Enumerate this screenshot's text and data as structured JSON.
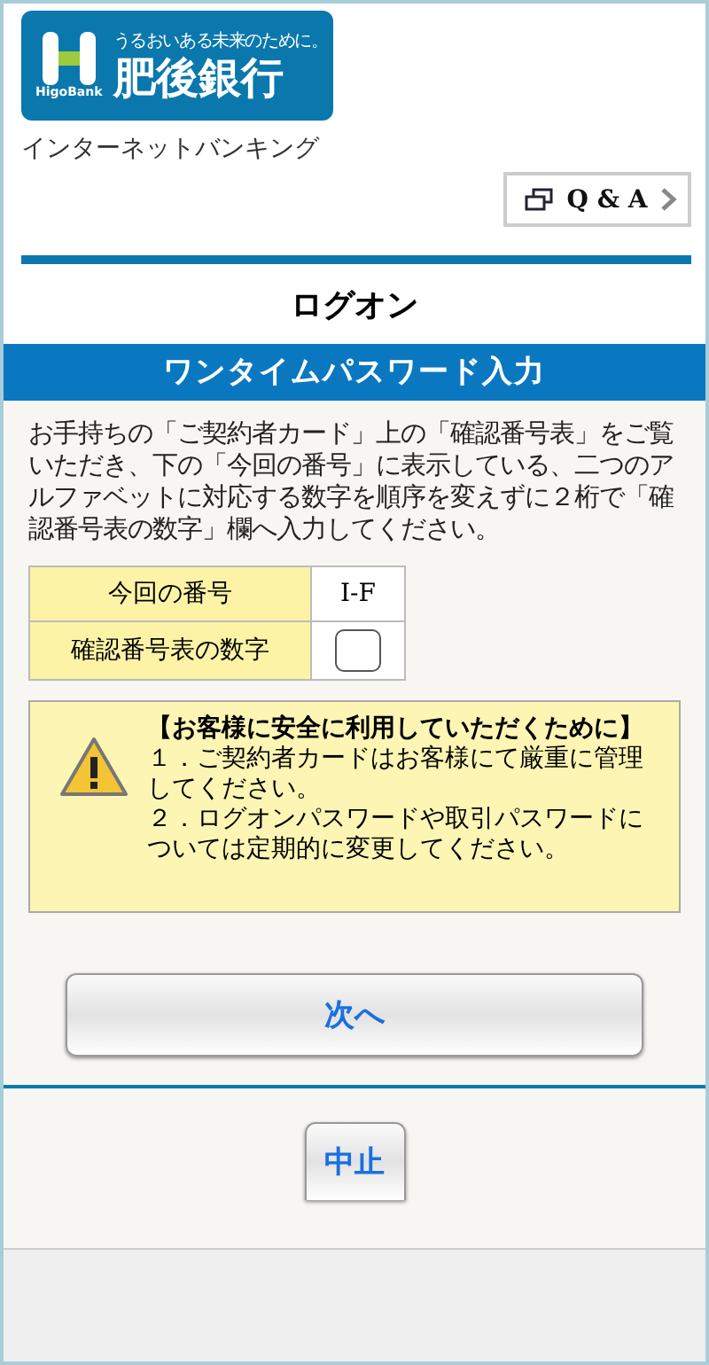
{
  "header": {
    "logo": {
      "tagline": "うるおいある未来のために。",
      "name": "肥後銀行",
      "roman": "HigoBank"
    },
    "service": "インターネットバンキング",
    "qa_button": {
      "label": "Q & A"
    }
  },
  "page_title": "ログオン",
  "section_title": "ワンタイムパスワード入力",
  "instructions": "お手持ちの「ご契約者カード」上の「確認番号表」をご覧いただき、下の「今回の番号」に表示している、二つのアルファベットに対応する数字を順序を変えずに２桁で「確認番号表の数字」欄へ入力してください。",
  "form_rows": [
    {
      "kind": "text",
      "label": "今回の番号",
      "value": "I-F"
    },
    {
      "kind": "input",
      "label": "確認番号表の数字"
    }
  ],
  "warning": {
    "title": "【お客様に安全に利用していただくために】",
    "items": [
      "１．ご契約者カードはお客様にて厳重に管理してください。",
      "２．ログオンパスワードや取引パスワードについては定期的に変更してください。"
    ]
  },
  "buttons": {
    "next": "次へ",
    "cancel": "中止"
  }
}
